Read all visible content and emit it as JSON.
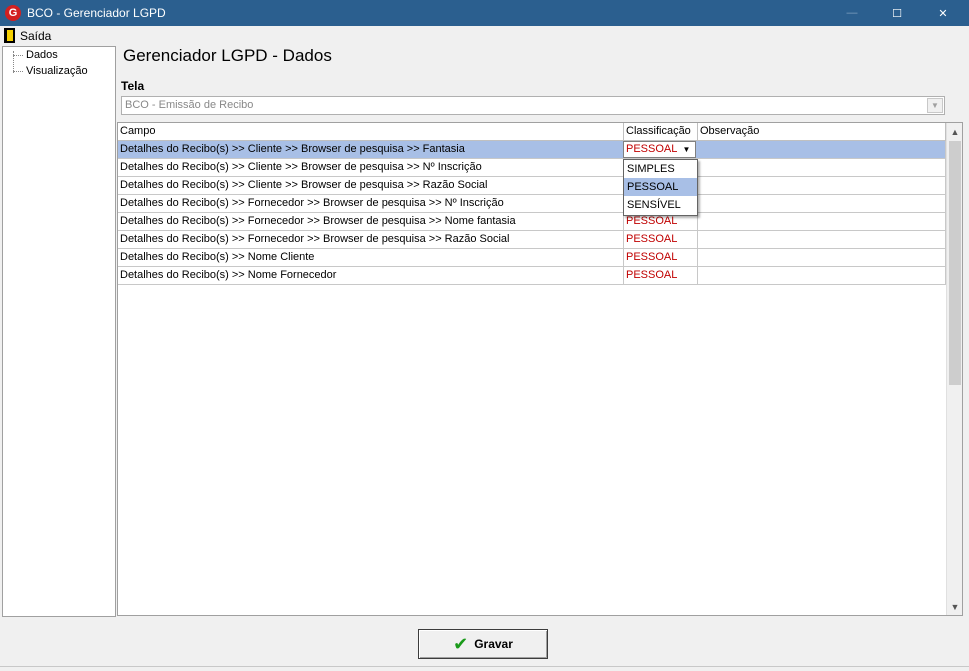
{
  "window": {
    "app_icon": "G",
    "title": "BCO - Gerenciador LGPD",
    "minimize_icon": "—",
    "maximize_icon": "☐",
    "close_icon": "✕"
  },
  "menu": {
    "exit_label": "Saída"
  },
  "tree": {
    "items": [
      "Dados",
      "Visualização"
    ]
  },
  "page": {
    "title": "Gerenciador LGPD - Dados",
    "tela_label": "Tela",
    "tela_value": "BCO - Emissão de Recibo"
  },
  "grid": {
    "columns": [
      "Campo",
      "Classificação",
      "Observação"
    ],
    "rows": [
      {
        "campo": "Detalhes do Recibo(s) >> Cliente >> Browser de pesquisa >> Fantasia",
        "classificacao": "PESSOAL",
        "observacao": ""
      },
      {
        "campo": "Detalhes do Recibo(s) >> Cliente >> Browser de pesquisa >> Nº Inscrição",
        "classificacao": "",
        "observacao": ""
      },
      {
        "campo": "Detalhes do Recibo(s) >> Cliente >> Browser de pesquisa >> Razão Social",
        "classificacao": "",
        "observacao": ""
      },
      {
        "campo": "Detalhes do Recibo(s) >> Fornecedor >> Browser de pesquisa >> Nº Inscrição",
        "classificacao": "",
        "observacao": ""
      },
      {
        "campo": "Detalhes do Recibo(s) >> Fornecedor >> Browser de pesquisa >> Nome fantasia",
        "classificacao": "PESSOAL",
        "observacao": ""
      },
      {
        "campo": "Detalhes do Recibo(s) >> Fornecedor >> Browser de pesquisa >> Razão Social",
        "classificacao": "PESSOAL",
        "observacao": ""
      },
      {
        "campo": "Detalhes do Recibo(s) >> Nome Cliente",
        "classificacao": "PESSOAL",
        "observacao": ""
      },
      {
        "campo": "Detalhes do Recibo(s) >> Nome Fornecedor",
        "classificacao": "PESSOAL",
        "observacao": ""
      }
    ],
    "editor_value": "PESSOAL",
    "dropdown_options": [
      "SIMPLES",
      "PESSOAL",
      "SENSÍVEL"
    ],
    "dropdown_highlighted": "PESSOAL"
  },
  "footer": {
    "save_label": "Gravar",
    "save_icon": "✔"
  },
  "colors": {
    "titlebar": "#2b5f8f",
    "selection": "#a8bfe6",
    "classification_text": "#c00000",
    "save_check": "#1a9a1a"
  }
}
